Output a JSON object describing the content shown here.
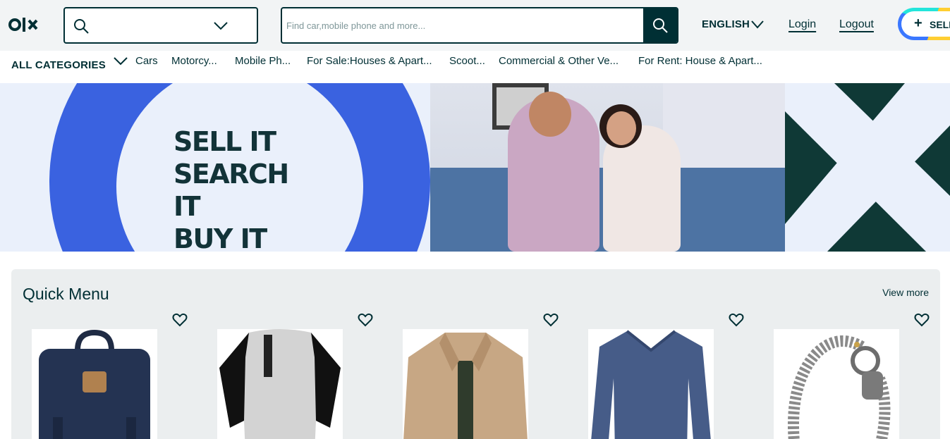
{
  "header": {
    "search_placeholder": "Find car,mobile phone and more...",
    "language": "ENGLISH",
    "login": "Login",
    "logout": "Logout",
    "sell": "SELL"
  },
  "categories": {
    "all": "ALL CATEGORIES",
    "items": [
      "Cars",
      "Motorcy...",
      "Mobile Ph...",
      "For Sale:Houses & Apart...",
      "Scoot...",
      "Commercial & Other Ve...",
      "For Rent: House & Apart..."
    ]
  },
  "banner": {
    "lines": [
      "SELL IT",
      "SEARCH IT",
      "BUY IT"
    ]
  },
  "quick_menu": {
    "title": "Quick Menu",
    "view_more": "View more",
    "items": [
      "backpack",
      "raglan henley shirt",
      "beige jacket",
      "blue v-neck sweater",
      "silver chain bracelet"
    ]
  },
  "colors": {
    "brand_dark": "#002f34",
    "banner_blue": "#3a62e0",
    "panel_bg": "#ebeeef"
  }
}
